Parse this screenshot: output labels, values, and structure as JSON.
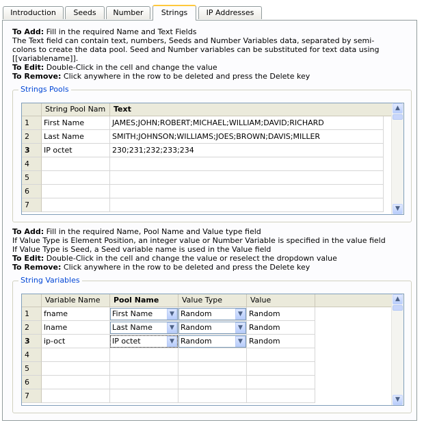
{
  "tabs": [
    {
      "label": "Introduction"
    },
    {
      "label": "Seeds"
    },
    {
      "label": "Number"
    },
    {
      "label": "Strings"
    },
    {
      "label": "IP Addresses"
    }
  ],
  "strings_info": {
    "add_label": "To Add:",
    "add_text": " Fill in the required Name and Text Fields",
    "line2": "The Text field can contain text, numbers, Seeds and Number Variables data, separated by semi-",
    "line3": "colons to create the data pool. Seed and Number variables can be substituted for text data using",
    "line4": "[[variablename]].",
    "edit_label": "To Edit:",
    "edit_text": " Double-Click in the cell and change the value",
    "remove_label": "To Remove:",
    "remove_text": " Click anywhere in the row to be deleted and press the Delete key"
  },
  "pools": {
    "title": "Strings Pools",
    "col_name": "String Pool Nam",
    "col_text": "Text",
    "rows": [
      {
        "num": "1",
        "name": "First Name",
        "text": "JAMES;JOHN;ROBERT;MICHAEL;WILLIAM;DAVID;RICHARD"
      },
      {
        "num": "2",
        "name": "Last Name",
        "text": "SMITH;JOHNSON;WILLIAMS;JOES;BROWN;DAVIS;MILLER"
      },
      {
        "num": "3",
        "name": "IP octet",
        "text": "230;231;232;233;234"
      },
      {
        "num": "4",
        "name": "",
        "text": ""
      },
      {
        "num": "5",
        "name": "",
        "text": ""
      },
      {
        "num": "6",
        "name": "",
        "text": ""
      },
      {
        "num": "7",
        "name": "",
        "text": ""
      }
    ]
  },
  "vars_info": {
    "add_label": "To Add:",
    "add_text": " Fill in the required Name, Pool Name and Value type field",
    "line2": "If Value Type is Element Position, an integer value or Number Variable is specified in the value field",
    "line3": "If Value Type is Seed, a Seed variable name is used in the Value field",
    "edit_label": "To Edit:",
    "edit_text": " Double-Click in the cell and change the value or reselect the dropdown value",
    "remove_label": "To Remove:",
    "remove_text": " Click anywhere in the row to be deleted and press the Delete key"
  },
  "variables": {
    "title": "String Variables",
    "col_var": "Variable Name",
    "col_pool": "Pool Name",
    "col_type": "Value Type",
    "col_value": "Value",
    "rows": [
      {
        "num": "1",
        "var": "fname",
        "pool": "First Name",
        "type": "Random",
        "value": "Random"
      },
      {
        "num": "2",
        "var": "lname",
        "pool": "Last Name",
        "type": "Random",
        "value": "Random"
      },
      {
        "num": "3",
        "var": "ip-oct",
        "pool": "IP octet",
        "type": "Random",
        "value": "Random"
      },
      {
        "num": "4",
        "var": "",
        "pool": "",
        "type": "",
        "value": ""
      },
      {
        "num": "5",
        "var": "",
        "pool": "",
        "type": "",
        "value": ""
      },
      {
        "num": "6",
        "var": "",
        "pool": "",
        "type": "",
        "value": ""
      },
      {
        "num": "7",
        "var": "",
        "pool": "",
        "type": "",
        "value": ""
      }
    ]
  }
}
